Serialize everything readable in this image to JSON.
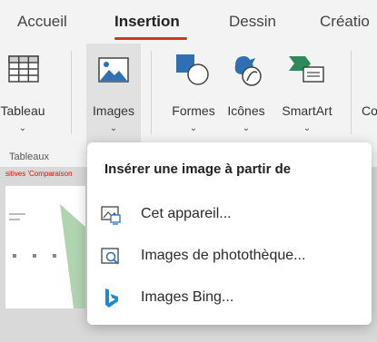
{
  "tabs": [
    "Accueil",
    "Insertion",
    "Dessin",
    "Créatio"
  ],
  "ribbon": {
    "buttons": [
      {
        "label": "Tableau",
        "icon": "table-icon"
      },
      {
        "label": "Images",
        "icon": "image-icon"
      },
      {
        "label": "Formes",
        "icon": "shapes-icon"
      },
      {
        "label": "Icônes",
        "icon": "icons-icon"
      },
      {
        "label": "SmartArt",
        "icon": "smartart-icon"
      },
      {
        "label": "Co",
        "icon": ""
      }
    ],
    "group_label": "Tableaux",
    "chevron": "⌄"
  },
  "slide": {
    "text": "sitives 'Comparaison"
  },
  "menu": {
    "title": "Insérer une image à partir de",
    "items": [
      {
        "label": "Cet appareil...",
        "icon": "device-image-icon"
      },
      {
        "label": "Images de photothèque...",
        "icon": "stock-images-icon"
      },
      {
        "label": "Images Bing...",
        "icon": "bing-icon"
      }
    ]
  },
  "colors": {
    "accent": "#c43e1c",
    "icon_blue": "#2f6fb3",
    "icon_green": "#2e8b57",
    "bing": "#1e8ad6"
  }
}
